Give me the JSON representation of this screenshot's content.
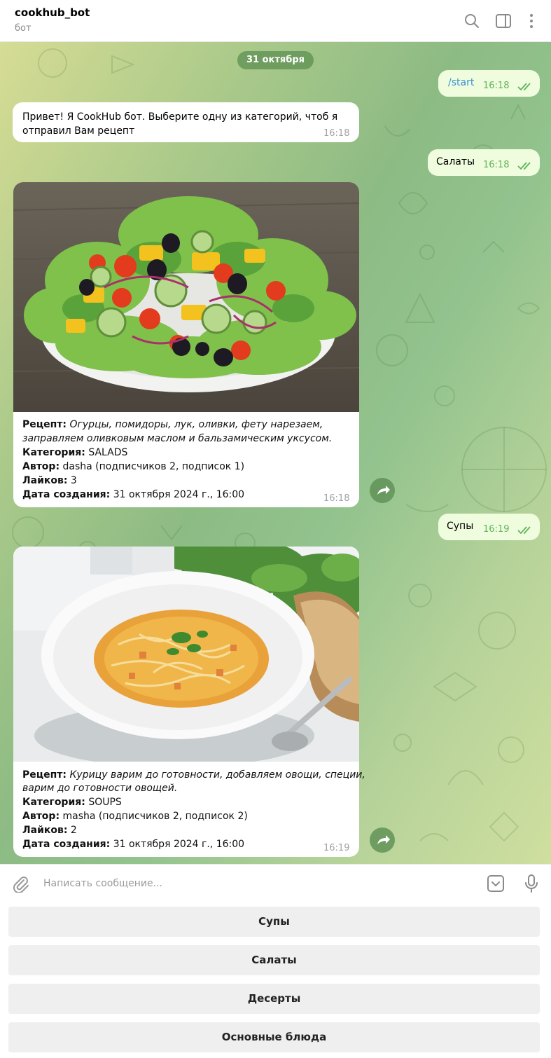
{
  "header": {
    "title": "cookhub_bot",
    "subtitle": "бот"
  },
  "chat": {
    "date_label": "31 октября",
    "messages": [
      {
        "dir": "out",
        "text": "/start",
        "time": "16:18",
        "is_command": true
      },
      {
        "dir": "in",
        "text_line1": "Привет! Я CookHub бот. Выберите одну из категорий, чтоб я",
        "text_line2": "отправил Вам рецепт",
        "time": "16:18"
      },
      {
        "dir": "out",
        "text": "Салаты",
        "time": "16:18"
      },
      {
        "dir": "in",
        "photo": "greek-salad-photo",
        "recipe_label": "Рецепт:",
        "recipe_line1": "Огурцы, помидоры, лук, оливки, фету нарезаем,",
        "recipe_line2": "заправляем оливковым маслом и бальзамическим уксусом.",
        "category_label": "Категория:",
        "category": "SALADS",
        "author_label": "Автор:",
        "author": "dasha (подписчиков 2, подписок 1)",
        "likes_label": "Лайков:",
        "likes": "3",
        "created_label": "Дата создания:",
        "created": "31 октября 2024 г., 16:00",
        "time": "16:18"
      },
      {
        "dir": "out",
        "text": "Супы",
        "time": "16:19"
      },
      {
        "dir": "in",
        "photo": "noodle-soup-photo",
        "recipe_label": "Рецепт:",
        "recipe_line1": "Курицу варим до готовности, добавляем овощи, специи,",
        "recipe_line2": "варим до готовности овощей.",
        "category_label": "Категория:",
        "category": "SOUPS",
        "author_label": "Автор:",
        "author": "masha (подписчиков 2, подписок 2)",
        "likes_label": "Лайков:",
        "likes": "2",
        "created_label": "Дата создания:",
        "created": "31 октября 2024 г., 16:00",
        "time": "16:19"
      }
    ]
  },
  "composer": {
    "placeholder": "Написать сообщение..."
  },
  "keyboard": {
    "buttons": [
      "Супы",
      "Салаты",
      "Десерты",
      "Основные блюда"
    ]
  },
  "icons": {
    "header": [
      "search-icon",
      "sidebar-toggle-icon",
      "more-vertical-icon"
    ],
    "composer": [
      "paperclip-icon",
      "bot-keyboard-icon",
      "microphone-icon"
    ],
    "message": [
      "double-check-icon",
      "share-icon"
    ]
  },
  "colors": {
    "outgoing_bubble": "#effdde",
    "incoming_bubble": "#ffffff",
    "time_outgoing": "#5fb35a",
    "date_pill": "#5c8f52",
    "command_link": "#3a8fd6"
  }
}
